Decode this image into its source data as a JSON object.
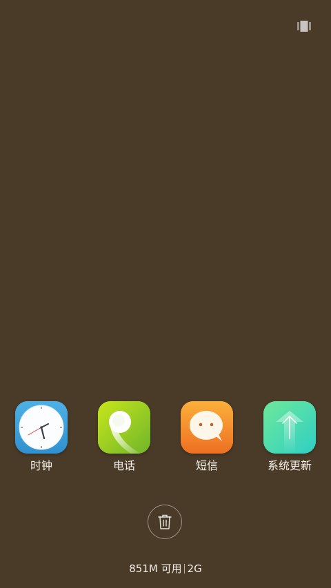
{
  "toolbar": {
    "toggle_icon": "multiwindow-icon"
  },
  "recent_apps": [
    {
      "label": "时钟",
      "icon": "clock-icon",
      "color": "#3ea3dd"
    },
    {
      "label": "电话",
      "icon": "phone-icon",
      "color": "#8ec51a"
    },
    {
      "label": "短信",
      "icon": "message-icon",
      "color": "#f3862a"
    },
    {
      "label": "系统更新",
      "icon": "system-update-icon",
      "color": "#3fd6b7"
    }
  ],
  "clear": {
    "icon": "trash-icon"
  },
  "memory": {
    "available": "851M 可用",
    "total": "2G"
  },
  "colors": {
    "background": "#4a3b28"
  }
}
